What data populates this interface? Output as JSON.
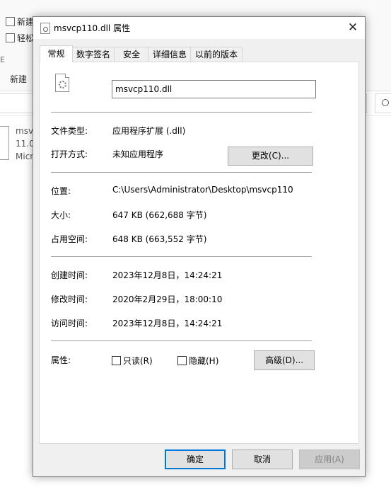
{
  "explorer": {
    "ribbon_items": [
      "新建",
      "轻松"
    ],
    "new_group_label": "新建",
    "edge_mark": "E",
    "file_lines": [
      "msv",
      "11.0",
      "Micr"
    ]
  },
  "dialog": {
    "title": "msvcp110.dll 属性",
    "close_glyph": "✕",
    "tabs": [
      "常规",
      "数字签名",
      "安全",
      "详细信息",
      "以前的版本"
    ],
    "active_tab": "常规",
    "file_name": "msvcp110.dll",
    "labels": {
      "file_type": "文件类型:",
      "opens_with": "打开方式:",
      "location": "位置:",
      "size": "大小:",
      "size_on_disk": "占用空间:",
      "created": "创建时间:",
      "modified": "修改时间:",
      "accessed": "访问时间:",
      "attributes": "属性:"
    },
    "values": {
      "file_type": "应用程序扩展 (.dll)",
      "opens_with": "未知应用程序",
      "location": "C:\\Users\\Administrator\\Desktop\\msvcp110",
      "size": "647 KB (662,688 字节)",
      "size_on_disk": "648 KB (663,552 字节)",
      "created": "2023年12月8日，14:24:21",
      "modified": "2020年2月29日，18:00:10",
      "accessed": "2023年12月8日，14:24:21"
    },
    "change_button": "更改(C)...",
    "attributes": {
      "readonly_label": "只读(R)",
      "readonly_checked": false,
      "hidden_label": "隐藏(H)",
      "hidden_checked": false,
      "advanced_button": "高级(D)..."
    },
    "footer": {
      "ok": "确定",
      "cancel": "取消",
      "apply": "应用(A)"
    }
  }
}
